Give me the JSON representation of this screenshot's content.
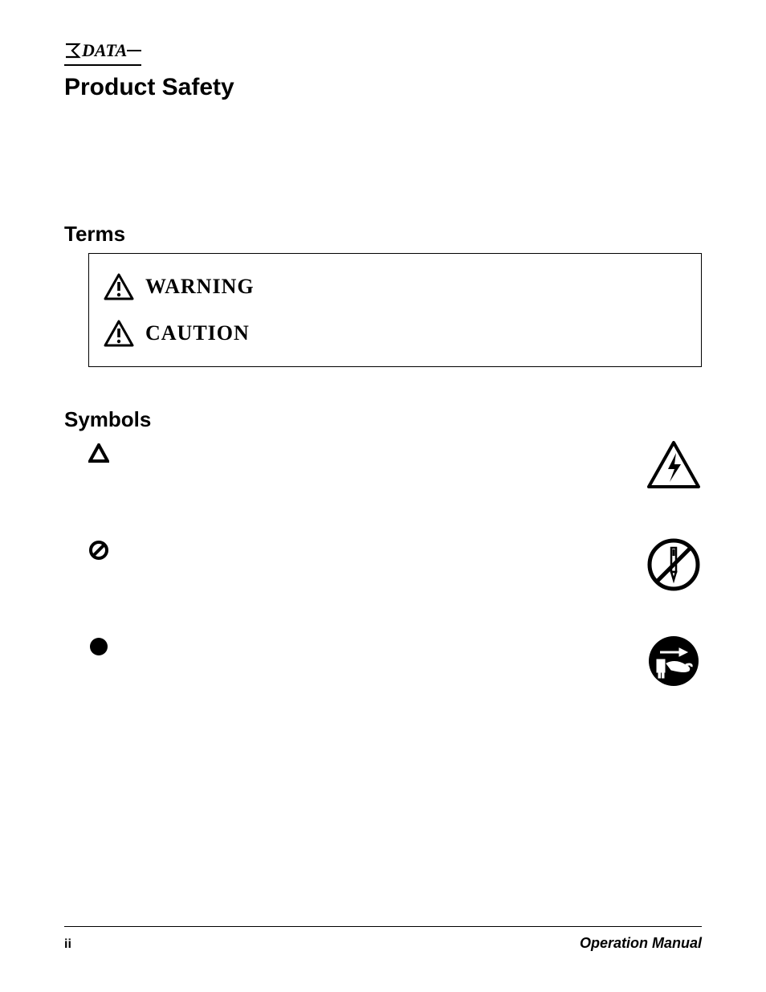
{
  "logo_text": "DATA",
  "page_title": "Product Safety",
  "sections": {
    "terms_heading": "Terms",
    "symbols_heading": "Symbols"
  },
  "terms": {
    "warning_label": "WARNING",
    "caution_label": "CAUTION"
  },
  "symbols": {
    "mark1": "triangle-outline-icon",
    "right1": "high-voltage-triangle-icon",
    "mark2": "prohibition-icon",
    "right2": "no-disassembly-icon",
    "mark3": "filled-circle-icon",
    "right3": "unplug-icon"
  },
  "footer": {
    "page_number": "ii",
    "doc_title": "Operation Manual"
  }
}
